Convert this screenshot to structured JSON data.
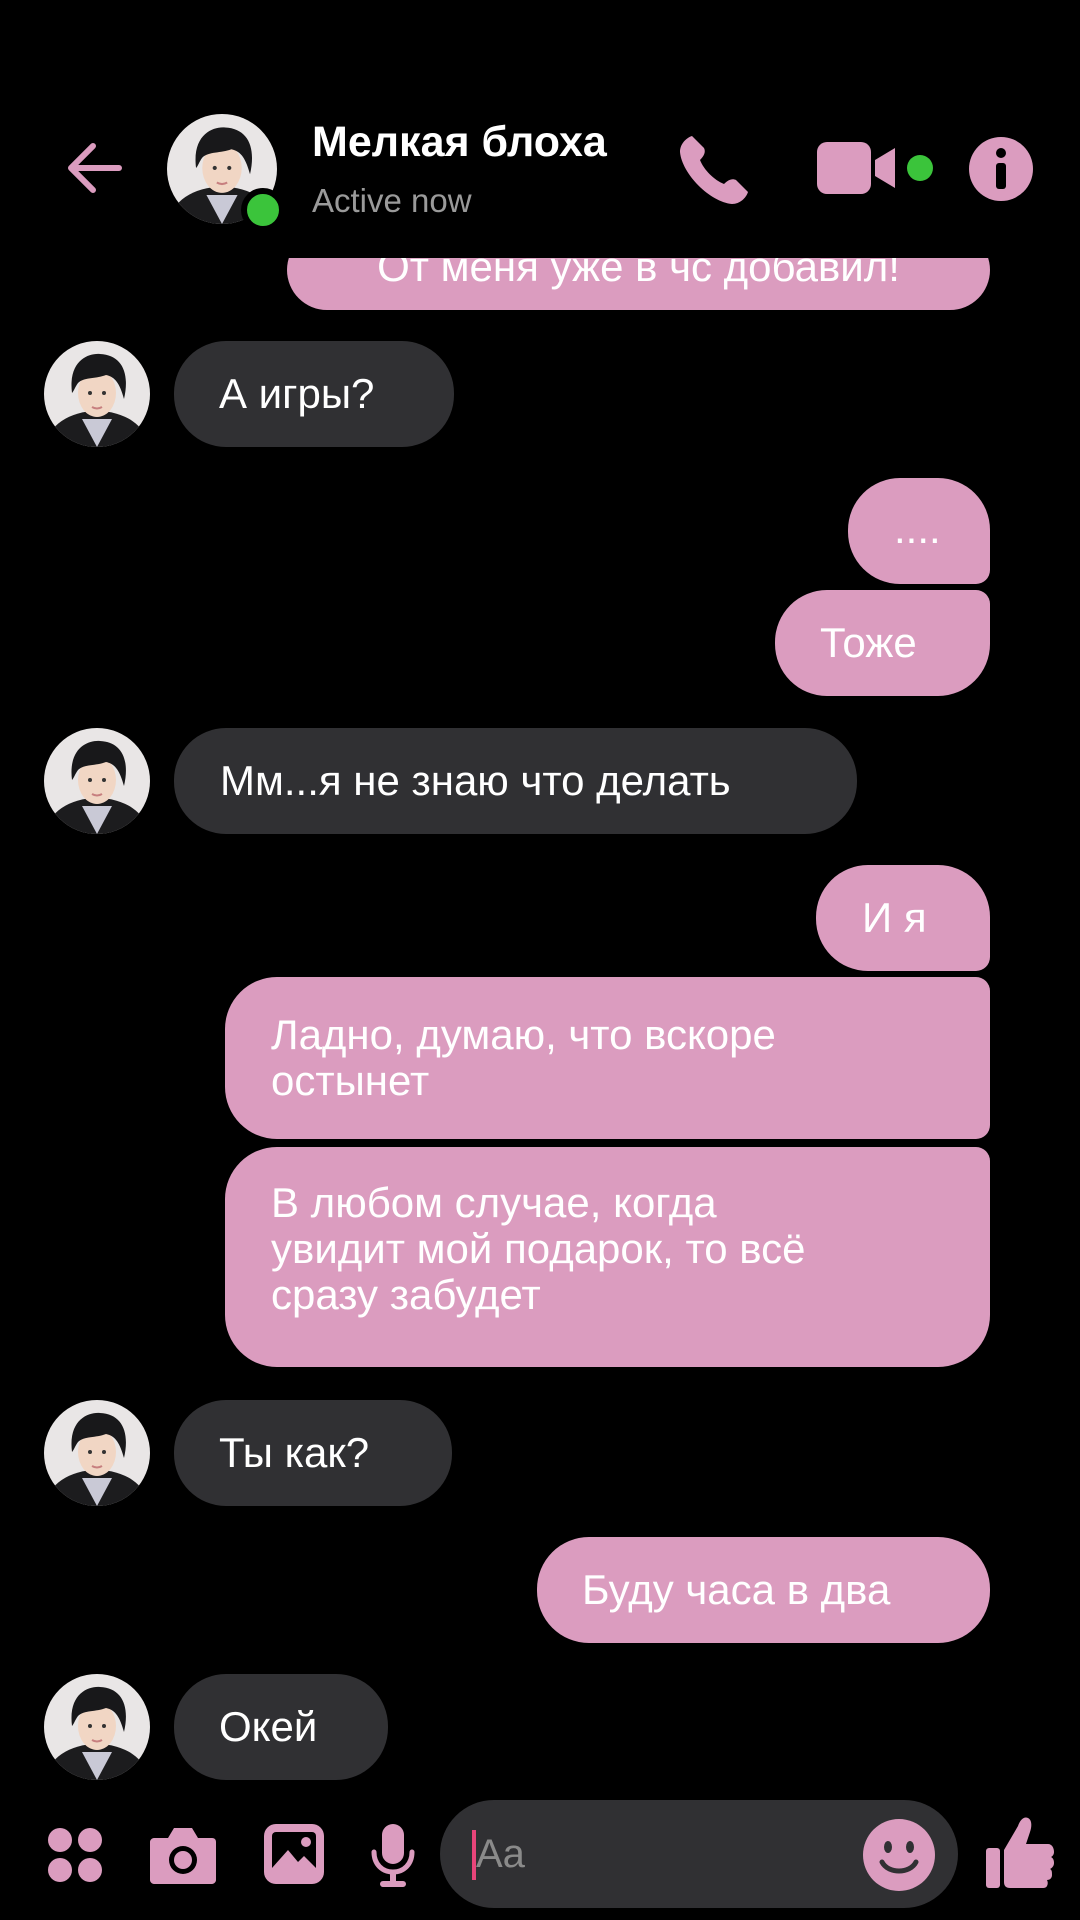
{
  "header": {
    "contact_name": "Мелкая блоха",
    "status": "Active now",
    "status_color": "#3bc43b"
  },
  "accent_color": "#db9cbf",
  "incoming_bubble_color": "#303033",
  "messages": [
    {
      "from": "me",
      "text": "От меня уже в чс добавил!"
    },
    {
      "from": "contact",
      "text": "А игры?"
    },
    {
      "from": "me",
      "text": "...."
    },
    {
      "from": "me",
      "text": "Тоже"
    },
    {
      "from": "contact",
      "text": "Мм...я не знаю что делать"
    },
    {
      "from": "me",
      "text": "И я"
    },
    {
      "from": "me",
      "text": "Ладно, думаю, что вскоре\nостынет"
    },
    {
      "from": "me",
      "text": "В любом случае, когда\nувидит мой подарок, то всё\nсразу забудет"
    },
    {
      "from": "contact",
      "text": "Ты как?"
    },
    {
      "from": "me",
      "text": "Буду часа в два"
    },
    {
      "from": "contact",
      "text": "Окей"
    }
  ],
  "composer": {
    "placeholder": "Aa"
  },
  "icons": [
    "back-arrow-icon",
    "phone-icon",
    "video-camera-icon",
    "info-icon",
    "apps-grid-icon",
    "camera-icon",
    "image-icon",
    "microphone-icon",
    "emoji-icon",
    "thumbs-up-icon"
  ]
}
